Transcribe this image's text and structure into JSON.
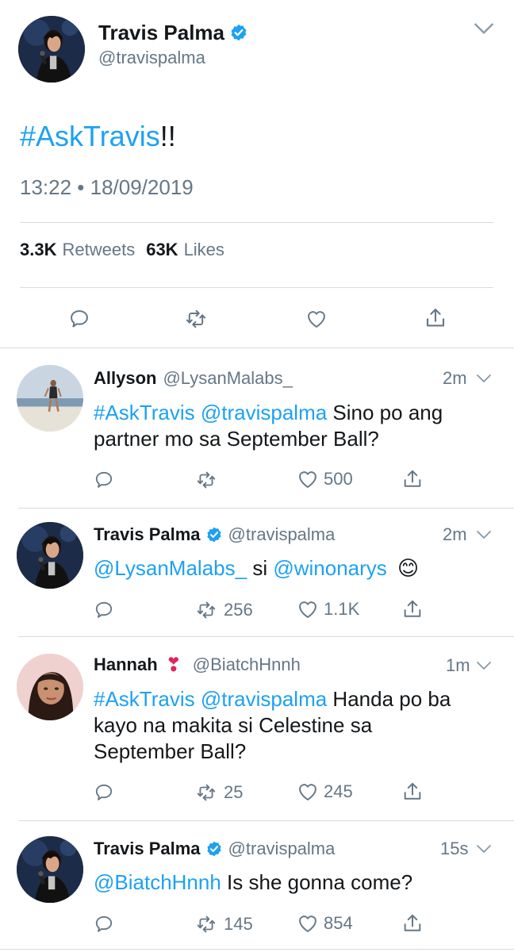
{
  "main_tweet": {
    "author_name": "Travis Palma",
    "handle": "@travispalma",
    "hashtag": "#AskTravis",
    "text_rest": "!!",
    "timestamp": "13:22 • 18/09/2019",
    "retweets_count": "3.3K",
    "retweets_label": "Retweets",
    "likes_count": "63K",
    "likes_label": "Likes"
  },
  "replies": [
    {
      "name": "Allyson",
      "handle": "@LysanMalabs_",
      "time": "2m",
      "line1_hashtag": "#AskTravis",
      "line1_mention": "@travispalma",
      "line1_rest": " Sino po ang",
      "line2": "partner mo sa September Ball?",
      "retweets": "",
      "likes": "500"
    },
    {
      "name": "Travis Palma",
      "handle": "@travispalma",
      "time": "2m",
      "mention1": "@LysanMalabs_",
      "mid": " si ",
      "mention2": "@winonarys",
      "emoji": "😊",
      "retweets": "256",
      "likes": "1.1K"
    },
    {
      "name": "Hannah",
      "emoji": "❣",
      "handle": "@BiatchHnnh",
      "time": "1m",
      "line1_hashtag": "#AskTravis",
      "line1_mention": "@travispalma",
      "line1_rest": " Handa po ba",
      "line2": "kayo na makita si Celestine sa",
      "line3": "September Ball?",
      "retweets": "25",
      "likes": "245"
    },
    {
      "name": "Travis Palma",
      "handle": "@travispalma",
      "time": "15s",
      "mention": "@BiatchHnnh",
      "rest": " Is she gonna come?",
      "retweets": "145",
      "likes": "854"
    }
  ],
  "colors": {
    "link": "#1da1f2",
    "muted": "#657786",
    "divider": "#d5dbe0",
    "verified": "#1da1f2"
  },
  "icons": [
    "reply-icon",
    "retweet-icon",
    "like-icon",
    "share-icon",
    "verified-badge-icon",
    "chevron-down-icon"
  ]
}
